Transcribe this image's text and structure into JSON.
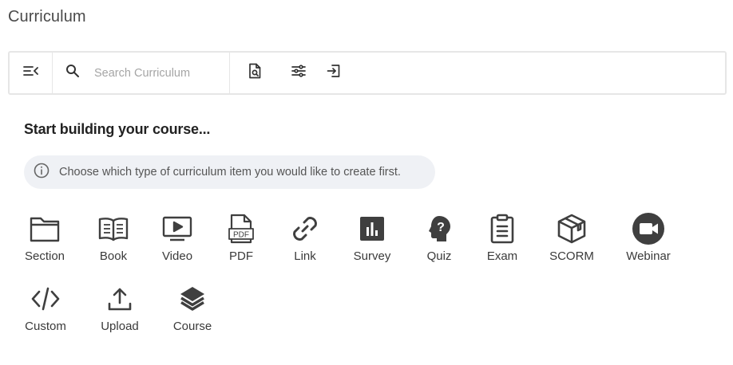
{
  "page": {
    "title": "Curriculum"
  },
  "toolbar": {
    "collapse_icon": "collapse-menu-icon",
    "search_icon": "search-icon",
    "search_placeholder": "Search Curriculum",
    "tools": [
      {
        "icon": "file-search-icon"
      },
      {
        "icon": "sliders-icon"
      },
      {
        "icon": "import-icon"
      }
    ]
  },
  "main": {
    "heading": "Start building your course...",
    "info": {
      "icon": "info-circle-icon",
      "text": "Choose which type of curriculum item you would like to create first."
    },
    "items": [
      {
        "label": "Section",
        "icon": "folder-icon"
      },
      {
        "label": "Book",
        "icon": "book-icon"
      },
      {
        "label": "Video",
        "icon": "video-icon"
      },
      {
        "label": "PDF",
        "icon": "pdf-icon"
      },
      {
        "label": "Link",
        "icon": "link-icon"
      },
      {
        "label": "Survey",
        "icon": "survey-icon"
      },
      {
        "label": "Quiz",
        "icon": "quiz-icon"
      },
      {
        "label": "Exam",
        "icon": "exam-icon"
      },
      {
        "label": "SCORM",
        "icon": "scorm-icon"
      },
      {
        "label": "Webinar",
        "icon": "webinar-icon"
      },
      {
        "label": "Custom",
        "icon": "code-icon"
      },
      {
        "label": "Upload",
        "icon": "upload-icon"
      },
      {
        "label": "Course",
        "icon": "layers-icon"
      }
    ]
  },
  "colors": {
    "icon": "#3f3f3f",
    "info_bg": "#eff1f5",
    "border": "#e6e6e6"
  }
}
